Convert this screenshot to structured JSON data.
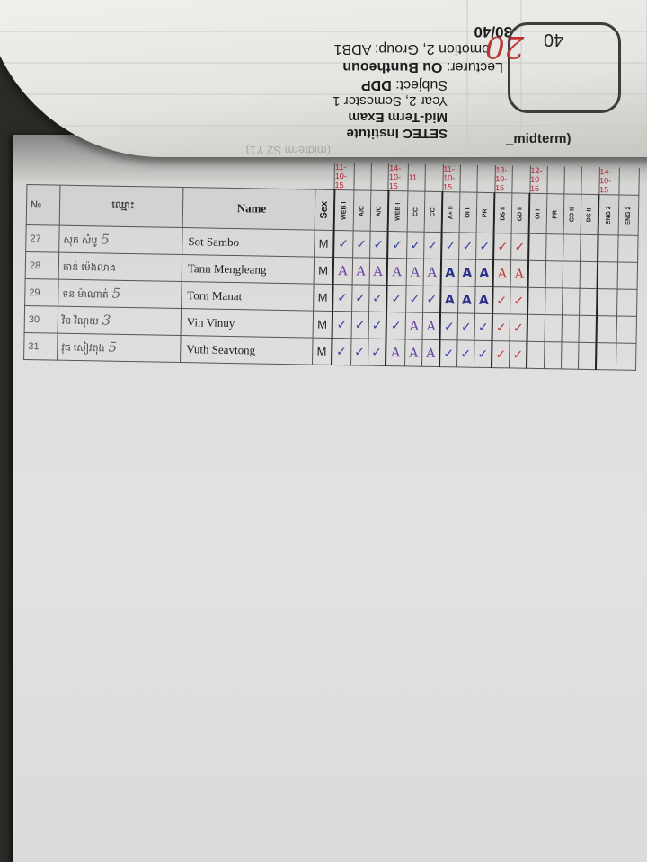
{
  "header_sheet": {
    "institute": "SETEC Institute",
    "exam_title": "Mid-Term Exam",
    "year_semester": "Year 2, Semester 1",
    "subject_label": "Subject:",
    "subject_value": "DDP",
    "lecturer_label": "Lecturer:",
    "lecturer_value": "Ou Buntheoun",
    "promotion_group": "omotion 2, Group: ADB1",
    "score_total": "30/40",
    "faded_text": "(midterm S2 Y1)",
    "box_score": "40",
    "handwritten_score": "20",
    "midterm_label": "_midterm)"
  },
  "table": {
    "header": {
      "no": "№",
      "khmer_name": "ឈ្មោះ",
      "name": "Name",
      "sex": "Sex"
    },
    "session_columns": [
      "WEB I",
      "A/C",
      "A/C",
      "WEB I",
      "CC",
      "CC",
      "A+ II",
      "OI I",
      "PR",
      "DS II",
      "GD II",
      "OI I",
      "PR",
      "GD II",
      "DS II",
      "ENG 2",
      "ENG 2"
    ],
    "dates": [
      "11-10-15",
      "",
      "",
      "14-10-15",
      "11",
      "",
      "11-10-15",
      "",
      "",
      "13-10-15",
      "",
      "12-10-15",
      "",
      "",
      "",
      "14-10-15",
      ""
    ],
    "rows": [
      {
        "no": "27",
        "khmer": "សុត សំបូ",
        "hscore": "5",
        "name": "Sot Sambo",
        "sex": "M",
        "marks": [
          "✓",
          "✓",
          "✓",
          "✓",
          "✓",
          "✓",
          "✓",
          "✓",
          "✓",
          "✓",
          "✓",
          "",
          "",
          "",
          "",
          "",
          ""
        ]
      },
      {
        "no": "28",
        "khmer": "តាន់ ម៉េងលាង",
        "hscore": "",
        "name": "Tann Mengleang",
        "sex": "M",
        "marks": [
          "A",
          "A",
          "A",
          "A",
          "A",
          "A",
          "A",
          "A",
          "A",
          "A",
          "A",
          "",
          "",
          "",
          "",
          "",
          ""
        ]
      },
      {
        "no": "29",
        "khmer": "ទន ម៉ាណាត់",
        "hscore": "5",
        "name": "Torn Manat",
        "sex": "M",
        "marks": [
          "✓",
          "✓",
          "✓",
          "✓",
          "✓",
          "✓",
          "A",
          "A",
          "A",
          "✓",
          "✓",
          "",
          "",
          "",
          "",
          "",
          ""
        ]
      },
      {
        "no": "30",
        "khmer": "វិន វិណុយ",
        "hscore": "3",
        "name": "Vin Vinuy",
        "sex": "M",
        "marks": [
          "✓",
          "✓",
          "✓",
          "✓",
          "A",
          "A",
          "✓",
          "✓",
          "✓",
          "✓",
          "✓",
          "",
          "",
          "",
          "",
          "",
          ""
        ]
      },
      {
        "no": "31",
        "khmer": "វុធ សៀវតុង",
        "hscore": "5",
        "name": "Vuth Seavtong",
        "sex": "M",
        "marks": [
          "✓",
          "✓",
          "✓",
          "A",
          "A",
          "A",
          "✓",
          "✓",
          "✓",
          "✓",
          "✓",
          "",
          "",
          "",
          "",
          "",
          ""
        ]
      }
    ]
  },
  "colors": {
    "blue": "#3a46a8",
    "red": "#c23a3a",
    "purple": "#6a3fa0"
  }
}
